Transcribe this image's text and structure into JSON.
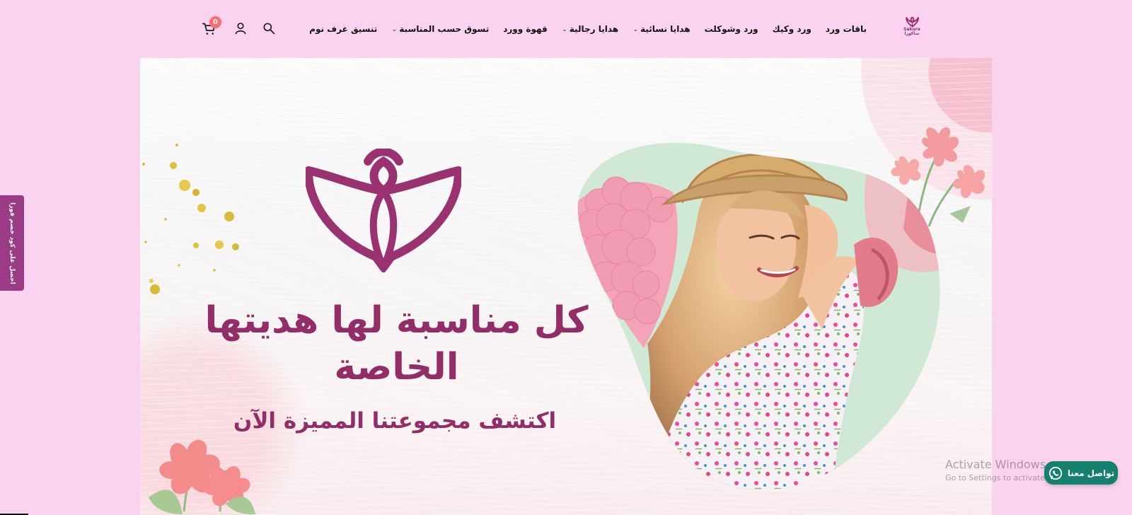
{
  "header": {
    "logo_text": "Sakura",
    "logo_arabic": "ساكورا",
    "nav_items": [
      {
        "label": "باقات ورد",
        "has_dropdown": false
      },
      {
        "label": "ورد وكيك",
        "has_dropdown": false
      },
      {
        "label": "ورد وشوكلت",
        "has_dropdown": false
      },
      {
        "label": "هدايا نسائية",
        "has_dropdown": true
      },
      {
        "label": "هدايا رجالية",
        "has_dropdown": true
      },
      {
        "label": "قهوة وورد",
        "has_dropdown": false
      },
      {
        "label": "تسوق حسب المناسبة",
        "has_dropdown": true
      },
      {
        "label": "تنسيق غرف نوم",
        "has_dropdown": false
      }
    ],
    "cart_count": "0"
  },
  "side_tab": {
    "label": "احصل على كود خصم فورا"
  },
  "hero": {
    "headline_line1": "كل مناسبة لها هديتها",
    "headline_line2": "الخاصة",
    "subheadline": "اكتشف مجموعتنا المميزة الآن"
  },
  "overlay": {
    "activate_title": "Activate Windows",
    "activate_subtitle": "Go to Settings to activate Windows."
  },
  "whatsapp": {
    "label": "تواصل معنا"
  },
  "colors": {
    "page_background": "#f9d3ef",
    "brand": "#922d68",
    "side_tab": "#9b3b86",
    "cart_badge": "#ff6b6b",
    "whatsapp": "#16806e"
  },
  "icons": {
    "search": "search-icon",
    "account": "user-icon",
    "cart": "shopping-cart-icon",
    "dropdown": "chevron-down-icon",
    "whatsapp": "whatsapp-icon"
  }
}
